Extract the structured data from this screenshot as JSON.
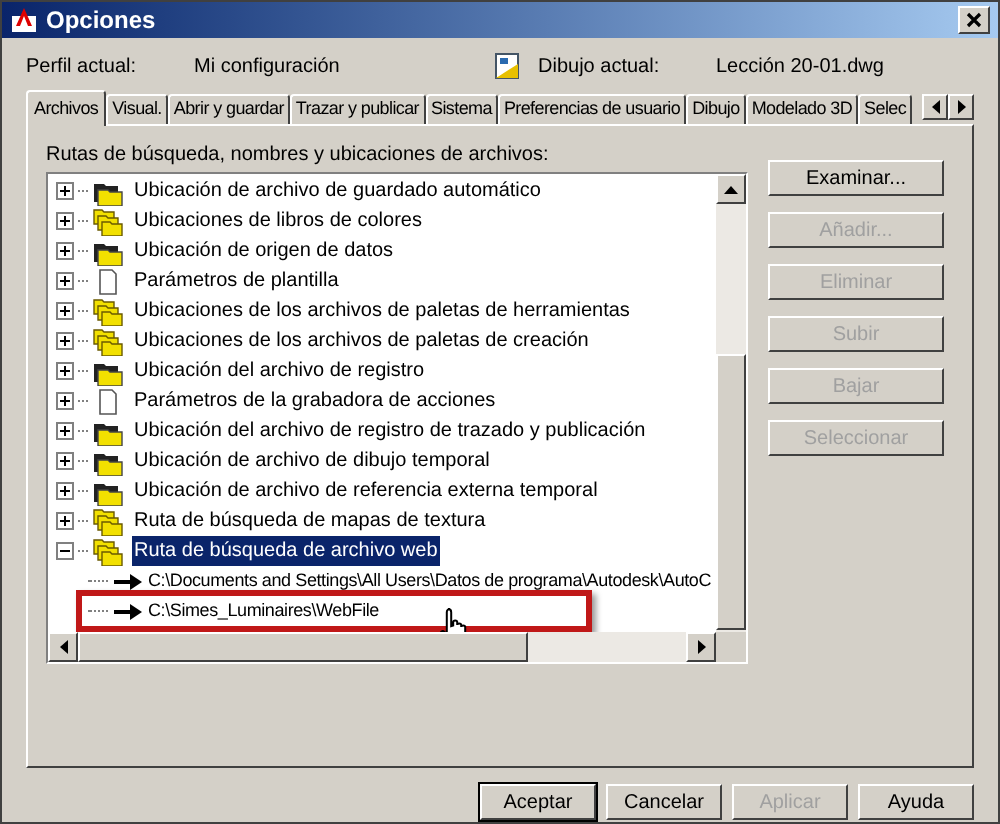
{
  "window": {
    "title": "Opciones"
  },
  "profile": {
    "label": "Perfil actual:",
    "value": "Mi configuración"
  },
  "drawing": {
    "label": "Dibujo actual:",
    "value": "Lección 20-01.dwg"
  },
  "tabs": [
    {
      "label": "Archivos",
      "selected": true
    },
    {
      "label": "Visual.",
      "selected": false
    },
    {
      "label": "Abrir y guardar",
      "selected": false
    },
    {
      "label": "Trazar y publicar",
      "selected": false
    },
    {
      "label": "Sistema",
      "selected": false
    },
    {
      "label": "Preferencias de usuario",
      "selected": false
    },
    {
      "label": "Dibujo",
      "selected": false
    },
    {
      "label": "Modelado 3D",
      "selected": false
    },
    {
      "label": "Selec",
      "selected": false
    }
  ],
  "tree_label": "Rutas de búsqueda, nombres y ubicaciones de archivos:",
  "tree": [
    {
      "label": "Ubicación de archivo de guardado automático",
      "kind": "folder",
      "expanded": false,
      "selected": false
    },
    {
      "label": "Ubicaciones de libros de colores",
      "kind": "folders",
      "expanded": false,
      "selected": false
    },
    {
      "label": "Ubicación de origen de datos",
      "kind": "folder",
      "expanded": false,
      "selected": false
    },
    {
      "label": "Parámetros de plantilla",
      "kind": "document",
      "expanded": false,
      "selected": false
    },
    {
      "label": "Ubicaciones de los archivos de paletas de herramientas",
      "kind": "folders",
      "expanded": false,
      "selected": false
    },
    {
      "label": "Ubicaciones de los archivos de paletas de creación",
      "kind": "folders",
      "expanded": false,
      "selected": false
    },
    {
      "label": "Ubicación del archivo de registro",
      "kind": "folder",
      "expanded": false,
      "selected": false
    },
    {
      "label": "Parámetros de la grabadora de acciones",
      "kind": "document",
      "expanded": false,
      "selected": false
    },
    {
      "label": "Ubicación del archivo de registro de trazado y publicación",
      "kind": "folder",
      "expanded": false,
      "selected": false
    },
    {
      "label": "Ubicación de archivo de dibujo temporal",
      "kind": "folder",
      "expanded": false,
      "selected": false
    },
    {
      "label": "Ubicación de archivo de referencia externa temporal",
      "kind": "folder",
      "expanded": false,
      "selected": false
    },
    {
      "label": "Ruta de búsqueda de mapas de textura",
      "kind": "folders",
      "expanded": false,
      "selected": false
    },
    {
      "label": "Ruta de búsqueda de archivo web",
      "kind": "folders",
      "expanded": true,
      "selected": true,
      "children": [
        {
          "label": "C:\\Documents and Settings\\All Users\\Datos de programa\\Autodesk\\AutoC",
          "highlighted": false
        },
        {
          "label": "C:\\Simes_Luminaires\\WebFile",
          "highlighted": true
        }
      ]
    }
  ],
  "side_buttons": [
    {
      "label": "Examinar...",
      "disabled": false
    },
    {
      "label": "Añadir...",
      "disabled": true
    },
    {
      "label": "Eliminar",
      "disabled": true
    },
    {
      "label": "Subir",
      "disabled": true
    },
    {
      "label": "Bajar",
      "disabled": true
    },
    {
      "label": "Seleccionar",
      "disabled": true
    }
  ],
  "footer_buttons": [
    {
      "label": "Aceptar",
      "disabled": false,
      "default": true
    },
    {
      "label": "Cancelar",
      "disabled": false,
      "default": false
    },
    {
      "label": "Aplicar",
      "disabled": true,
      "default": false
    },
    {
      "label": "Ayuda",
      "disabled": false,
      "default": false
    }
  ]
}
